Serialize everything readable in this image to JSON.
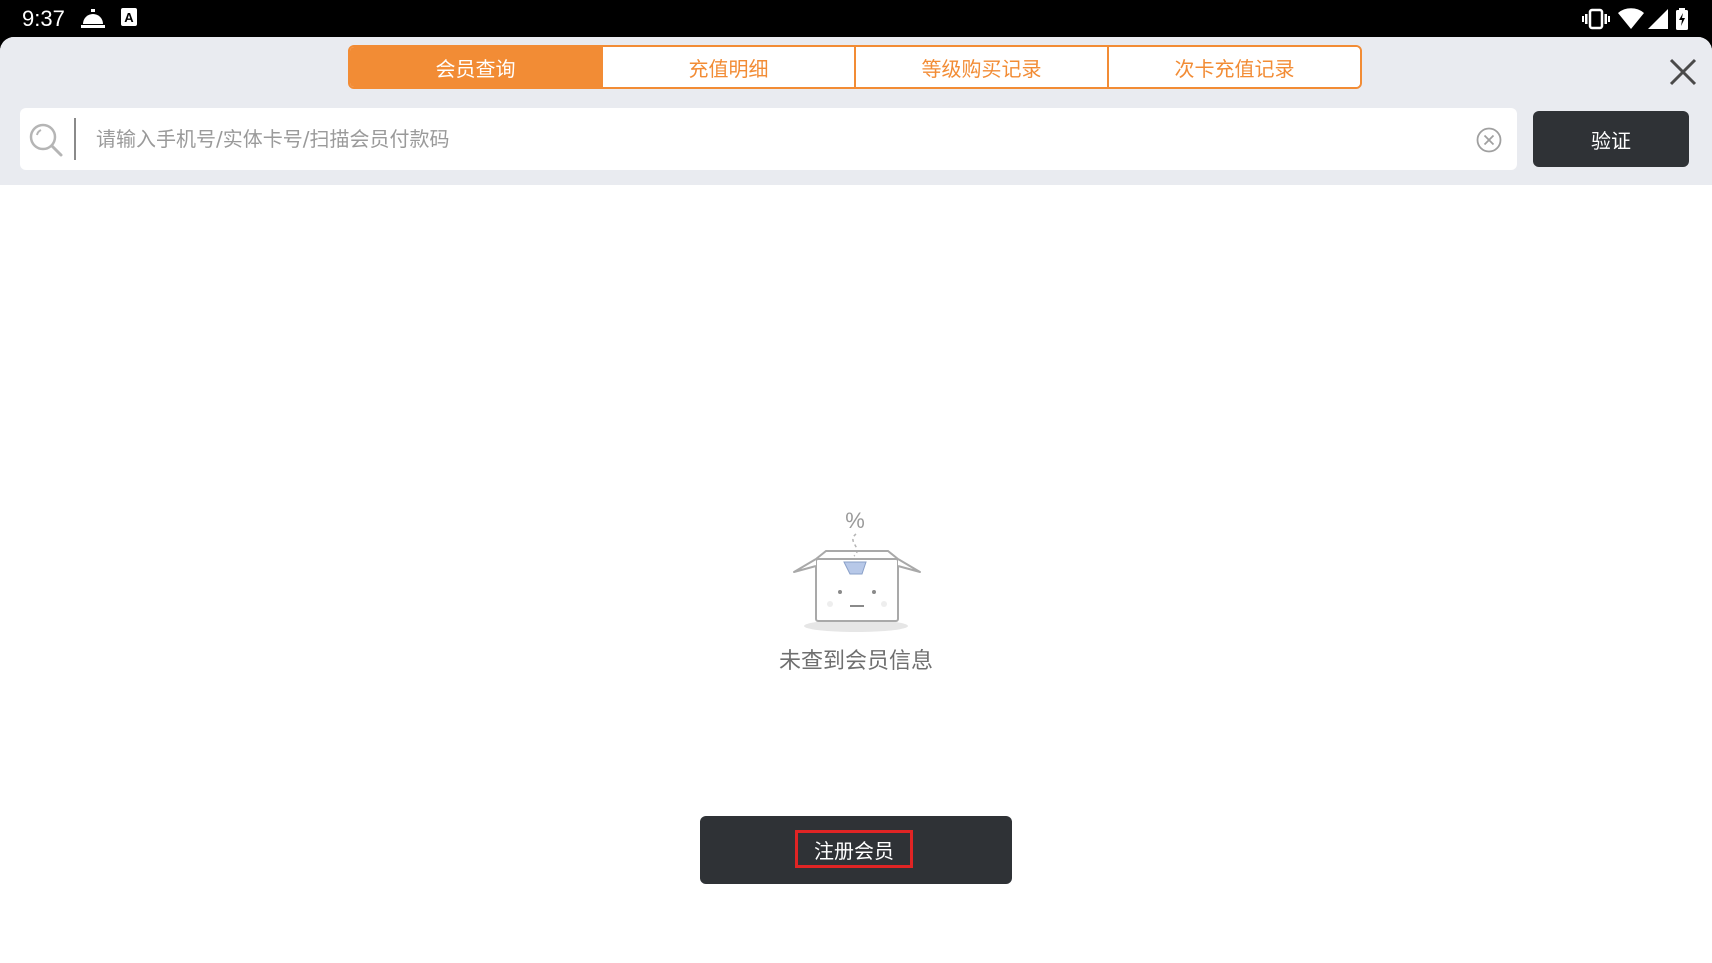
{
  "status_bar": {
    "time": "9:37",
    "left_icons": [
      "room-service-icon",
      "text-a-icon"
    ],
    "right_icons": [
      "vibrate-icon",
      "wifi-icon",
      "signal-icon",
      "battery-icon"
    ]
  },
  "tabs": [
    {
      "label": "会员查询",
      "active": true
    },
    {
      "label": "充值明细",
      "active": false
    },
    {
      "label": "等级购买记录",
      "active": false
    },
    {
      "label": "次卡充值记录",
      "active": false
    }
  ],
  "search": {
    "placeholder": "请输入手机号/实体卡号/扫描会员付款码",
    "value": ""
  },
  "verify_button": "验证",
  "empty_state": {
    "message": "未查到会员信息"
  },
  "register_button": "注册会员",
  "colors": {
    "accent": "#f28c35",
    "dark_button": "#2f3236",
    "highlight_border": "#e02424",
    "header_bg": "#e9ebf0"
  }
}
